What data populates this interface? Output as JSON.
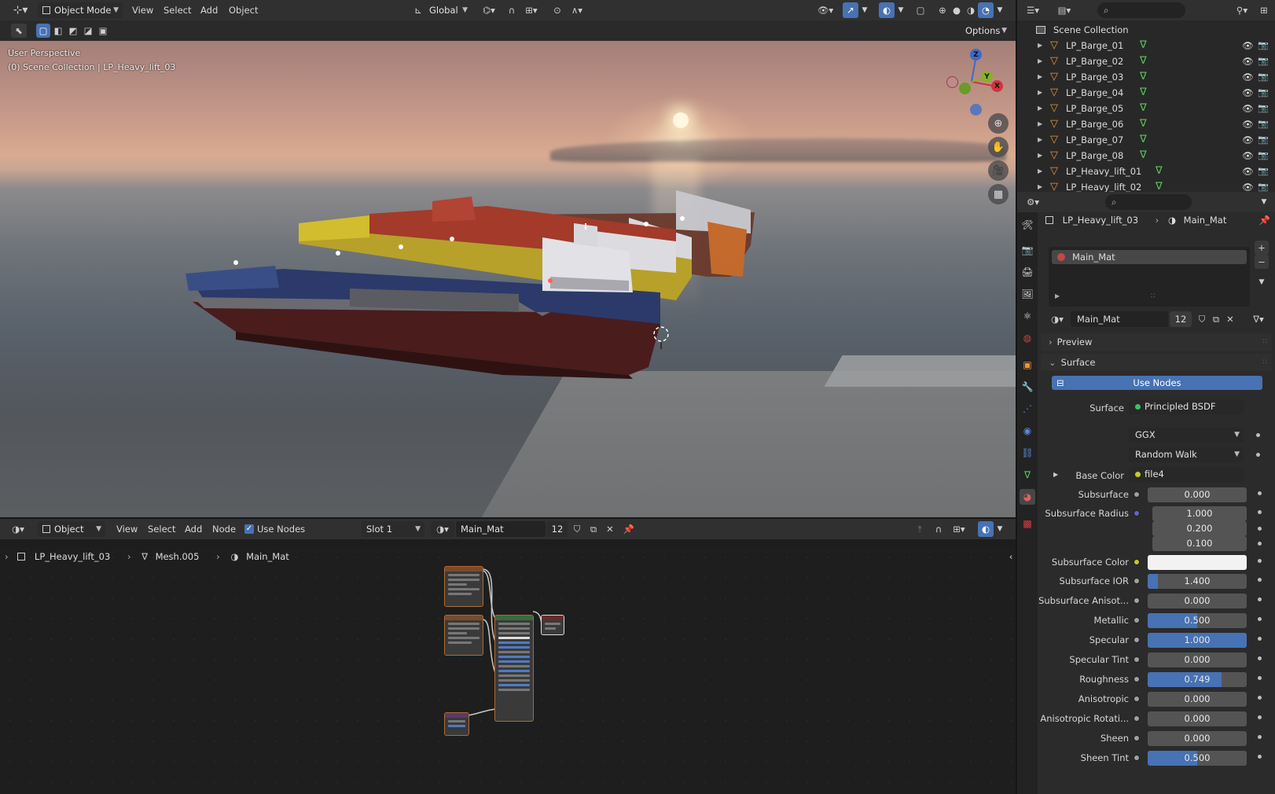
{
  "top_bar": {
    "mode": "Object Mode",
    "menus": [
      "View",
      "Select",
      "Add",
      "Object"
    ],
    "orientation": "Global",
    "options": "Options"
  },
  "viewport": {
    "perspective": "User Perspective",
    "collection": "(0) Scene Collection | LP_Heavy_lift_03",
    "gizmo": {
      "z": "Z",
      "y": "Y",
      "x": "X"
    }
  },
  "node_header": {
    "mode": "Object",
    "menus": [
      "View",
      "Select",
      "Add",
      "Node"
    ],
    "use_nodes": "Use Nodes",
    "slot": "Slot 1",
    "material": "Main_Mat",
    "users": "12"
  },
  "node_breadcrumb": [
    "LP_Heavy_lift_03",
    "Mesh.005",
    "Main_Mat"
  ],
  "outliner": {
    "root": "Scene Collection",
    "items": [
      "LP_Barge_01",
      "LP_Barge_02",
      "LP_Barge_03",
      "LP_Barge_04",
      "LP_Barge_05",
      "LP_Barge_06",
      "LP_Barge_07",
      "LP_Barge_08",
      "LP_Heavy_lift_01",
      "LP_Heavy_lift_02"
    ]
  },
  "properties": {
    "breadcrumb": [
      "LP_Heavy_lift_03",
      "Main_Mat"
    ],
    "slot_name": "Main_Mat",
    "material": "Main_Mat",
    "users": "12",
    "preview": "Preview",
    "surface_panel": "Surface",
    "use_nodes": "Use Nodes",
    "surface_label": "Surface",
    "surface_shader": "Principled BSDF",
    "distribution": "GGX",
    "subsurface_method": "Random Walk",
    "base_color_label": "Base Color",
    "base_color_value": "file4",
    "subsurface_radius_label": "Subsurface Radius",
    "subsurface_radius": [
      "1.000",
      "0.200",
      "0.100"
    ],
    "subsurface_color_label": "Subsurface Color",
    "fields": [
      {
        "label": "Subsurface",
        "value": "0.000",
        "fill": 0
      },
      {
        "label": "Subsurface IOR",
        "value": "1.400",
        "fill": 0.1
      },
      {
        "label": "Subsurface Anisot...",
        "value": "0.000",
        "fill": 0
      },
      {
        "label": "Metallic",
        "value": "0.500",
        "fill": 0.5
      },
      {
        "label": "Specular",
        "value": "1.000",
        "fill": 1
      },
      {
        "label": "Specular Tint",
        "value": "0.000",
        "fill": 0
      },
      {
        "label": "Roughness",
        "value": "0.749",
        "fill": 0.749
      },
      {
        "label": "Anisotropic",
        "value": "0.000",
        "fill": 0
      },
      {
        "label": "Anisotropic Rotati...",
        "value": "0.000",
        "fill": 0
      },
      {
        "label": "Sheen",
        "value": "0.000",
        "fill": 0
      },
      {
        "label": "Sheen Tint",
        "value": "0.500",
        "fill": 0.5
      }
    ]
  },
  "colors": {
    "accent": "#4772b3",
    "node_border": "#b06a30",
    "outliner_icon": "#e8963a"
  }
}
